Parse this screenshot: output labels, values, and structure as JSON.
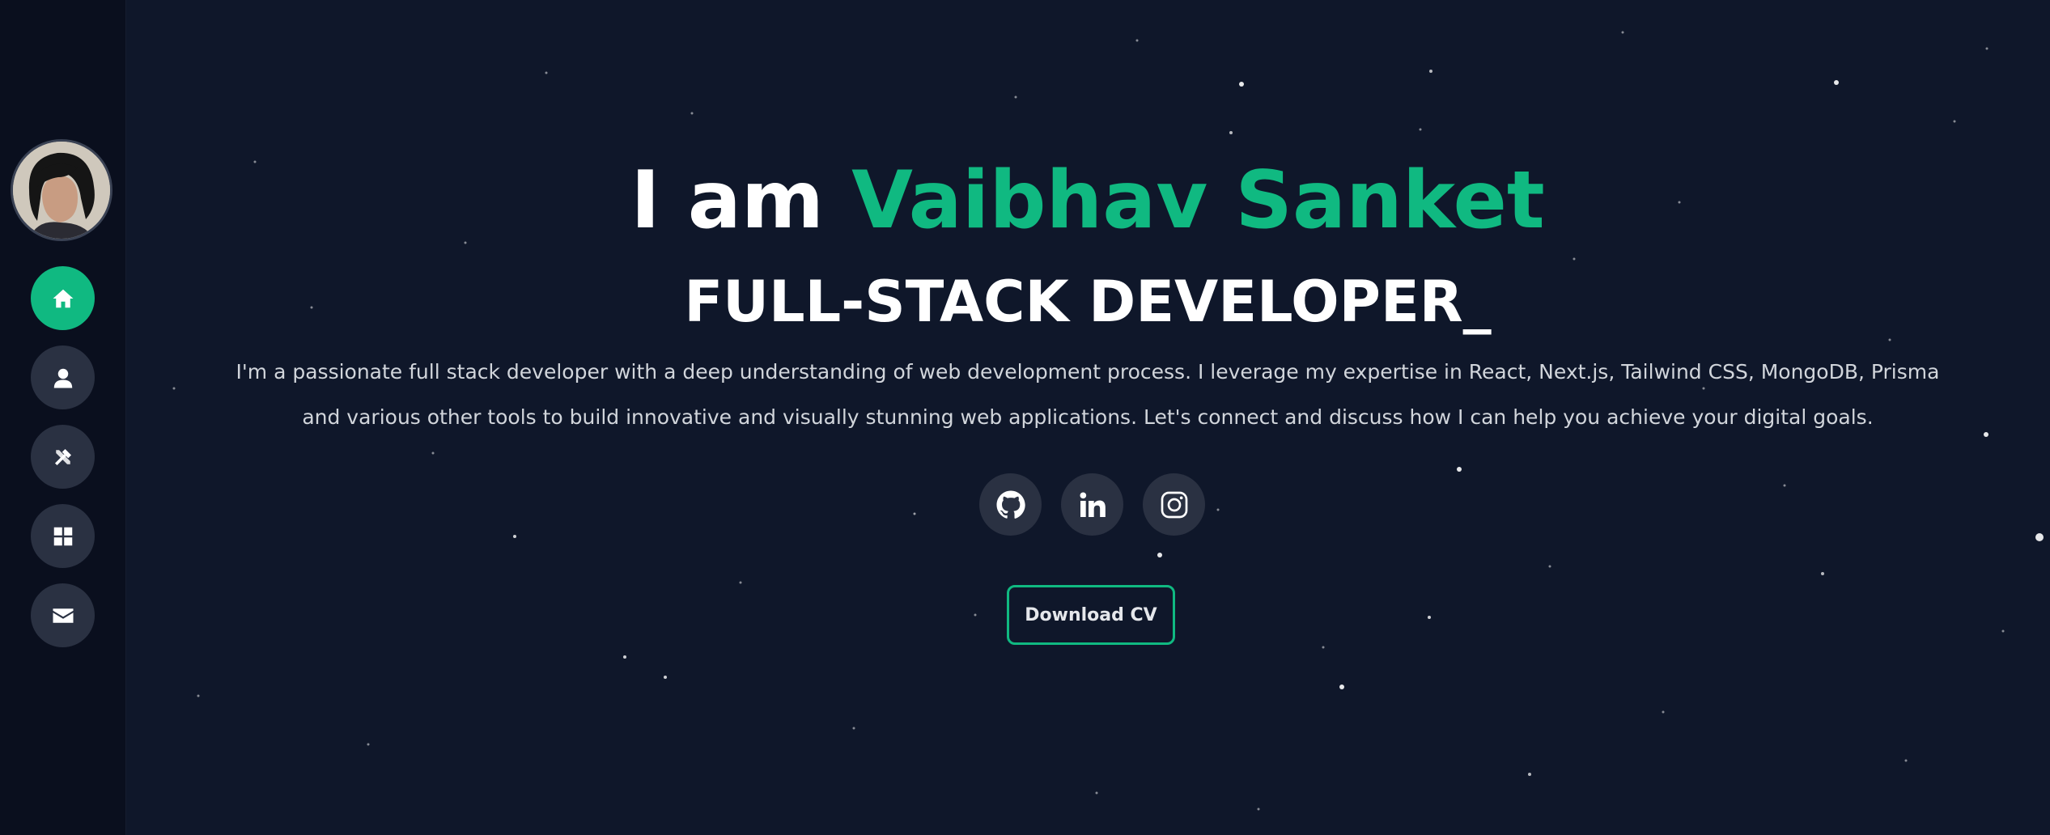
{
  "hero": {
    "greeting": "I am",
    "name": "Vaibhav Sanket",
    "role": "FULL-STACK DEVELOPER_",
    "bio_line1": "I'm a passionate full stack developer with a deep understanding of web development process. I leverage my expertise in React, Next.js, Tailwind CSS, MongoDB, Prisma",
    "bio_line2": "and various other tools to build innovative and visually stunning web applications. Let's connect and discuss how I can help you achieve your digital goals.",
    "cv_button": "Download CV"
  },
  "sidebar": {
    "items": [
      {
        "icon": "home-icon",
        "active": true
      },
      {
        "icon": "user-icon",
        "active": false
      },
      {
        "icon": "tools-icon",
        "active": false
      },
      {
        "icon": "grid-icon",
        "active": false
      },
      {
        "icon": "envelope-icon",
        "active": false
      }
    ]
  },
  "socials": [
    {
      "icon": "github-icon"
    },
    {
      "icon": "linkedin-icon"
    },
    {
      "icon": "instagram-icon"
    }
  ],
  "colors": {
    "background": "#0f172a",
    "accent": "#10b981",
    "button_bg": "#2a3142"
  }
}
